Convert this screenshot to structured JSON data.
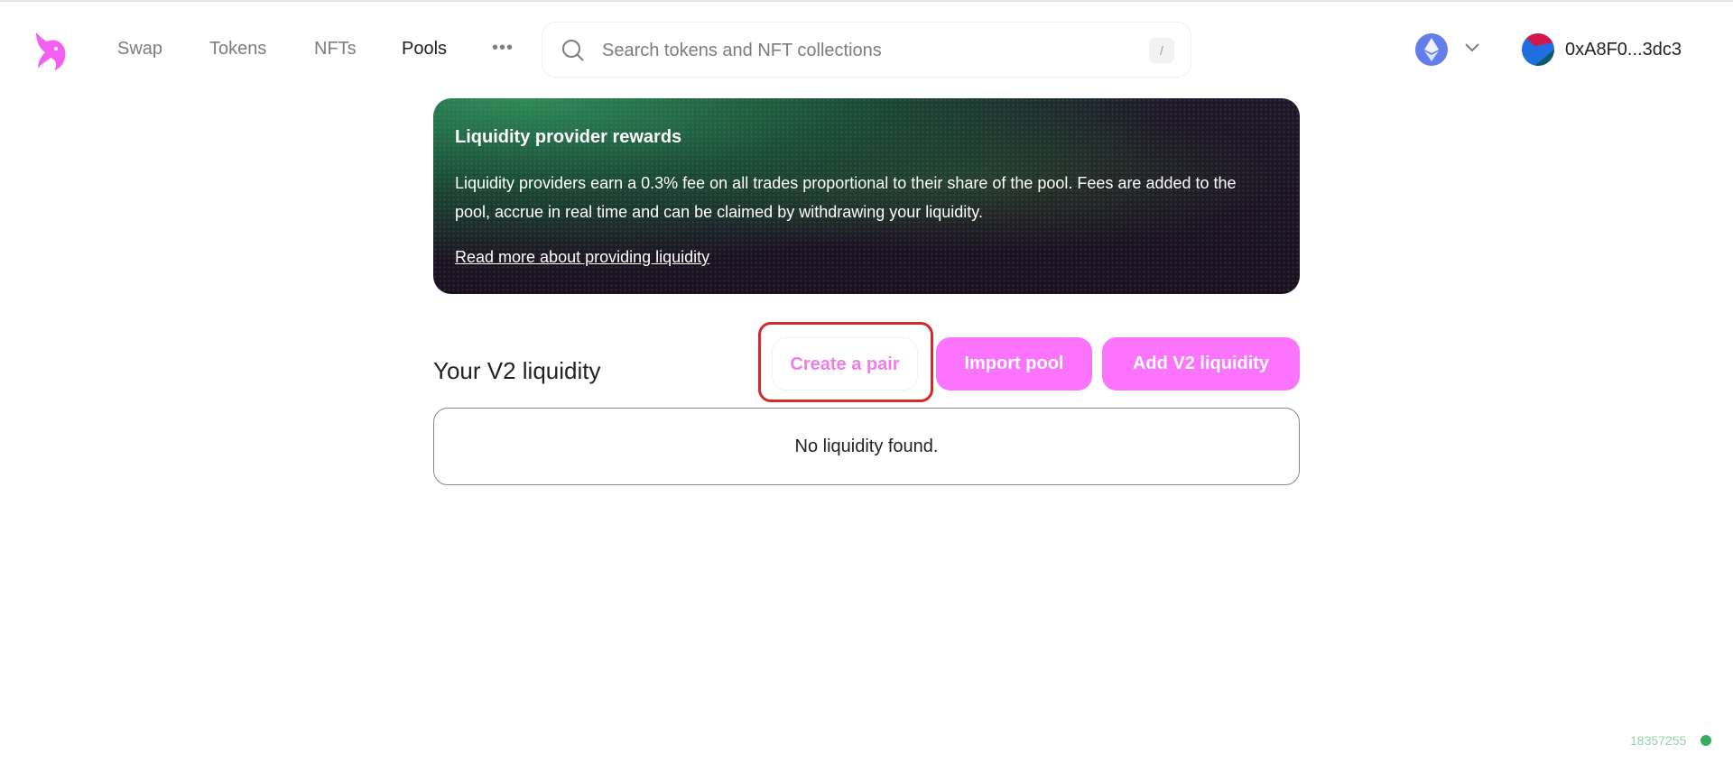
{
  "nav": {
    "logo": "uniswap-unicorn-logo",
    "items": [
      {
        "label": "Swap",
        "active": false
      },
      {
        "label": "Tokens",
        "active": false
      },
      {
        "label": "NFTs",
        "active": false
      },
      {
        "label": "Pools",
        "active": true
      }
    ],
    "more_label": "•••",
    "search": {
      "placeholder": "Search tokens and NFT collections",
      "value": "",
      "shortcut": "/"
    },
    "network": "ethereum",
    "account": "0xA8F0...3dc3"
  },
  "banner": {
    "title": "Liquidity provider rewards",
    "body": "Liquidity providers earn a 0.3% fee on all trades proportional to their share of the pool. Fees are added to the pool, accrue in real time and can be claimed by withdrawing your liquidity.",
    "link": "Read more about providing liquidity"
  },
  "liquidity": {
    "title": "Your V2 liquidity",
    "create_label": "Create a pair",
    "import_label": "Import pool",
    "add_label": "Add V2 liquidity",
    "empty_message": "No liquidity found."
  },
  "footer": {
    "block_number": "18357255",
    "status_color": "#3aaa62"
  },
  "colors": {
    "accent": "#fc74fe",
    "highlight": "#d42a2a"
  }
}
